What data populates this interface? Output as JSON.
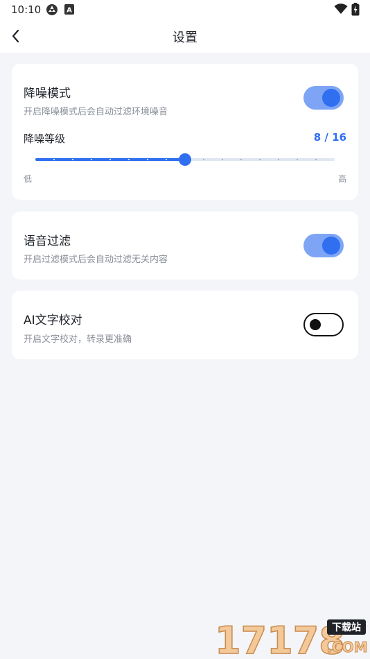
{
  "status_bar": {
    "time": "10:10",
    "icons": [
      "sync-icon",
      "keyboard-a-icon",
      "wifi-icon",
      "battery-icon"
    ],
    "keyboard_glyph": "A"
  },
  "nav": {
    "title": "设置",
    "back_icon": "chevron-left-icon"
  },
  "noise_reduction": {
    "title": "降噪模式",
    "description": "开启降噪模式后会自动过滤环境噪音",
    "enabled": true,
    "level_label": "降噪等级",
    "level_value": "8 / 16",
    "level": 8,
    "level_max": 16,
    "low_label": "低",
    "high_label": "高"
  },
  "voice_filter": {
    "title": "语音过滤",
    "description": "开启过滤模式后会自动过滤无关内容",
    "enabled": true
  },
  "ai_proofread": {
    "title": "AI文字校对",
    "description": "开启文字校对，转录更准确",
    "enabled": false
  },
  "watermark": {
    "main": "17178",
    "sub": "下载站",
    "domain": ".COM"
  },
  "colors": {
    "accent": "#2f6ff0",
    "toggle_on_track": "#7ea5f5",
    "background": "#f4f5f9",
    "card": "#ffffff"
  }
}
